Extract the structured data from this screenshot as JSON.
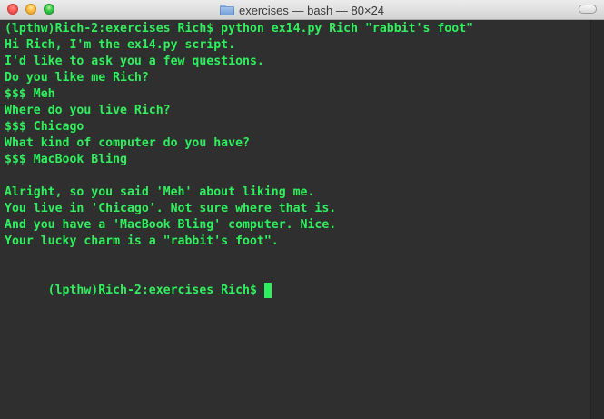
{
  "window": {
    "title": "exercises — bash — 80×24",
    "icon": "folder-icon",
    "colors": {
      "background": "#2f2f2f",
      "text": "#2ef05c",
      "titlebar": "#d3d3d3"
    }
  },
  "terminal": {
    "lines": [
      "(lpthw)Rich-2:exercises Rich$ python ex14.py Rich \"rabbit's foot\"",
      "Hi Rich, I'm the ex14.py script.",
      "I'd like to ask you a few questions.",
      "Do you like me Rich?",
      "$$$ Meh",
      "Where do you live Rich?",
      "$$$ Chicago",
      "What kind of computer do you have?",
      "$$$ MacBook Bling",
      "",
      "Alright, so you said 'Meh' about liking me.",
      "You live in 'Chicago'. Not sure where that is.",
      "And you have a 'MacBook Bling' computer. Nice.",
      "Your lucky charm is a \"rabbit's foot\".",
      "",
      "(lpthw)Rich-2:exercises Rich$"
    ]
  }
}
